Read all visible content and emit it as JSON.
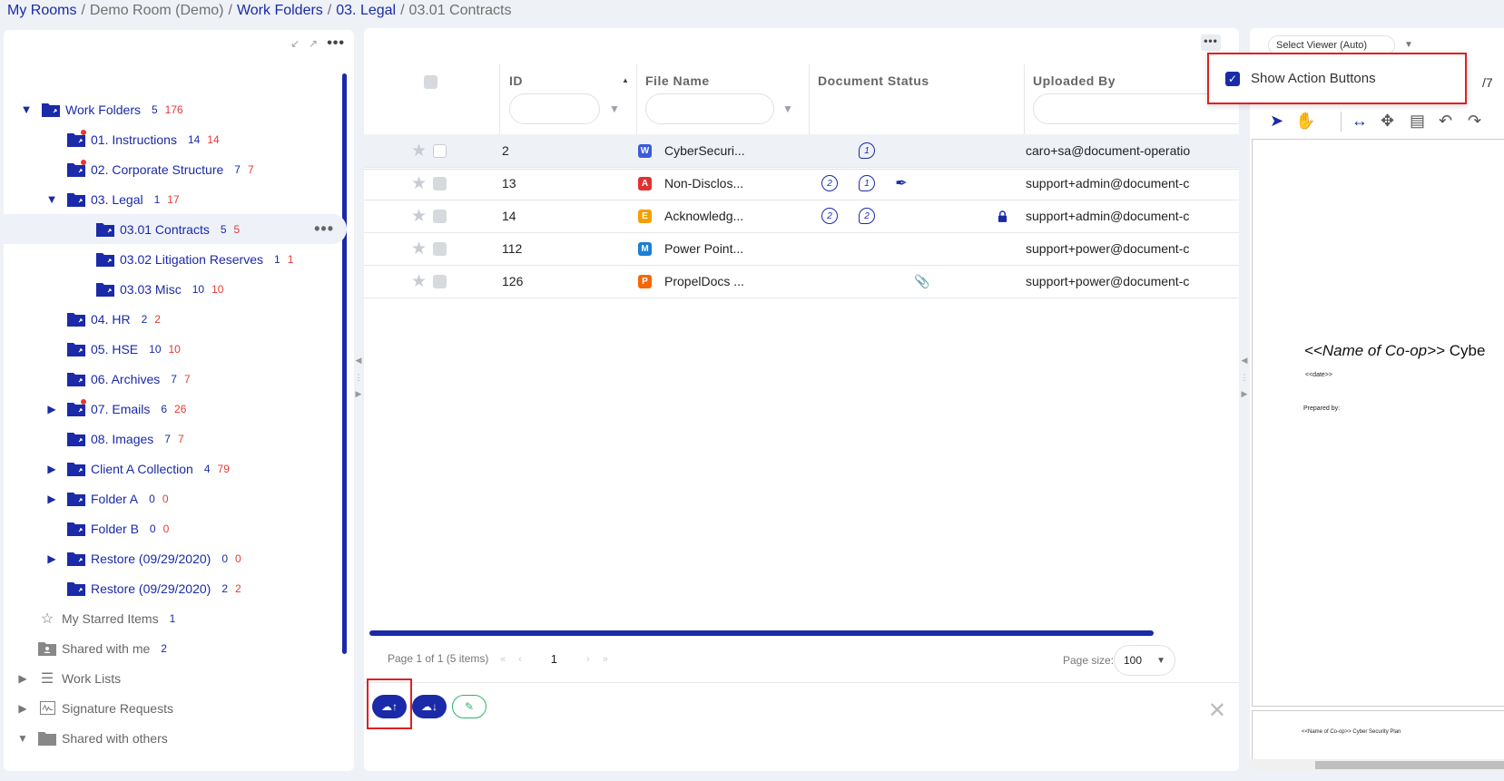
{
  "breadcrumb": {
    "items": [
      {
        "label": "My Rooms",
        "muted": false
      },
      {
        "label": "Demo Room (Demo)",
        "muted": true
      },
      {
        "label": "Work Folders",
        "muted": false
      },
      {
        "label": "03. Legal",
        "muted": false
      },
      {
        "label": "03.01 Contracts",
        "muted": true
      }
    ],
    "separator": "/"
  },
  "tree": {
    "root": {
      "label": "Work Folders",
      "count": "5",
      "count2": "176"
    },
    "items": [
      {
        "label": "01. Instructions",
        "count": "14",
        "count2": "14"
      },
      {
        "label": "02. Corporate Structure",
        "count": "7",
        "count2": "7"
      },
      {
        "label": "03. Legal",
        "count": "1",
        "count2": "17"
      },
      {
        "label": "03.01 Contracts",
        "count": "5",
        "count2": "5"
      },
      {
        "label": "03.02 Litigation Reserves",
        "count": "1",
        "count2": "1"
      },
      {
        "label": "03.03 Misc",
        "count": "10",
        "count2": "10"
      },
      {
        "label": "04. HR",
        "count": "2",
        "count2": "2"
      },
      {
        "label": "05. HSE",
        "count": "10",
        "count2": "10"
      },
      {
        "label": "06. Archives",
        "count": "7",
        "count2": "7"
      },
      {
        "label": "07. Emails",
        "count": "6",
        "count2": "26"
      },
      {
        "label": "08. Images",
        "count": "7",
        "count2": "7"
      },
      {
        "label": "Client A Collection",
        "count": "4",
        "count2": "79"
      },
      {
        "label": "Folder A",
        "count": "0",
        "count2": "0"
      },
      {
        "label": "Folder B",
        "count": "0",
        "count2": "0"
      },
      {
        "label": "Restore (09/29/2020)",
        "count": "0",
        "count2": "0"
      },
      {
        "label": "Restore (09/29/2020)",
        "count": "2",
        "count2": "2"
      }
    ],
    "starred": {
      "label": "My Starred Items",
      "count": "1"
    },
    "shared_with_me": {
      "label": "Shared with me",
      "count": "2"
    },
    "work_lists": {
      "label": "Work Lists"
    },
    "signature_requests": {
      "label": "Signature Requests"
    },
    "shared_with_others": {
      "label": "Shared with others"
    }
  },
  "grid": {
    "columns": {
      "id": "ID",
      "file_name": "File Name",
      "document_status": "Document Status",
      "uploaded_by": "Uploaded By"
    },
    "rows": [
      {
        "id": "2",
        "file": "CyberSecuri...",
        "type": "W",
        "type_color": "#3b5bdb",
        "uploaded_by": "caro+sa@document-operatio"
      },
      {
        "id": "13",
        "file": "Non-Disclos...",
        "type": "A",
        "type_color": "#e03131",
        "uploaded_by": "support+admin@document-c"
      },
      {
        "id": "14",
        "file": "Acknowledg...",
        "type": "E",
        "type_color": "#f59f00",
        "uploaded_by": "support+admin@document-c"
      },
      {
        "id": "112",
        "file": "Power Point...",
        "type": "M",
        "type_color": "#1c7ed6",
        "uploaded_by": "support+power@document-c"
      },
      {
        "id": "126",
        "file": "PropelDocs ...",
        "type": "P",
        "type_color": "#f76707",
        "uploaded_by": "support+power@document-c"
      }
    ],
    "status_badges": {
      "r1_comment": "1",
      "r2_versions": "2",
      "r2_comment": "1",
      "r3_versions": "2",
      "r3_comment": "2"
    }
  },
  "pager": {
    "info": "Page 1 of 1 (5 items)",
    "current": "1",
    "page_size_label": "Page size:",
    "page_size": "100"
  },
  "viewer": {
    "select_label": "Select Viewer (Auto)",
    "page_total": "/7",
    "doc_title_italic": "<<Name of Co-op>>",
    "doc_title_rest": " Cybe",
    "doc_date": "<<date>>",
    "doc_prepared": "Prepared by:",
    "doc_footer": "<<Name of Co-op>> Cyber Security Plan"
  },
  "menu": {
    "show_action_buttons": "Show Action Buttons"
  },
  "colors": {
    "brand": "#1a2aa8",
    "count_red": "#e53935",
    "highlight_red": "#e02020",
    "edit_green": "#2fb56a"
  }
}
